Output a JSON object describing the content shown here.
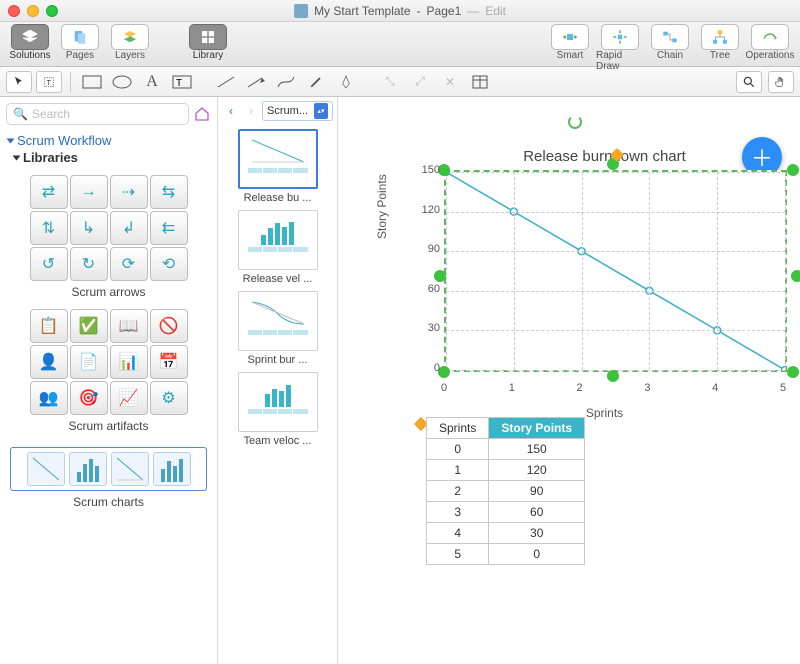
{
  "window": {
    "doc_title": "My Start Template",
    "page_name": "Page1",
    "mode": "Edit"
  },
  "toolbar_top": {
    "left": [
      {
        "id": "solutions",
        "label": "Solutions"
      },
      {
        "id": "pages",
        "label": "Pages"
      },
      {
        "id": "layers",
        "label": "Layers"
      }
    ],
    "library": {
      "label": "Library"
    },
    "right": [
      {
        "id": "smart",
        "label": "Smart"
      },
      {
        "id": "rapid",
        "label": "Rapid Draw"
      },
      {
        "id": "chain",
        "label": "Chain"
      },
      {
        "id": "tree",
        "label": "Tree"
      },
      {
        "id": "operations",
        "label": "Operations"
      }
    ]
  },
  "search": {
    "placeholder": "Search"
  },
  "tree": {
    "root": "Scrum Workflow",
    "sub": "Libraries"
  },
  "libraries": [
    {
      "name": "Scrum arrows"
    },
    {
      "name": "Scrum artifacts"
    },
    {
      "name": "Scrum charts"
    }
  ],
  "thumb_nav": {
    "dropdown": "Scrum..."
  },
  "thumbnails": [
    {
      "label": "Release bu ...",
      "selected": true
    },
    {
      "label": "Release vel ...",
      "selected": false
    },
    {
      "label": "Sprint bur ...",
      "selected": false
    },
    {
      "label": "Team veloc ...",
      "selected": false
    }
  ],
  "chart_data": {
    "type": "line",
    "title": "Release burndown chart",
    "xlabel": "Sprints",
    "ylabel": "Story Points",
    "x": [
      0,
      1,
      2,
      3,
      4,
      5
    ],
    "values": [
      150,
      120,
      90,
      60,
      30,
      0
    ],
    "ylim": [
      0,
      150
    ],
    "ytick_step": 30,
    "xlim": [
      0,
      5
    ]
  },
  "table": {
    "headers": [
      "Sprints",
      "Story Points"
    ],
    "rows": [
      [
        0,
        150
      ],
      [
        1,
        120
      ],
      [
        2,
        90
      ],
      [
        3,
        60
      ],
      [
        4,
        30
      ],
      [
        5,
        0
      ]
    ]
  }
}
